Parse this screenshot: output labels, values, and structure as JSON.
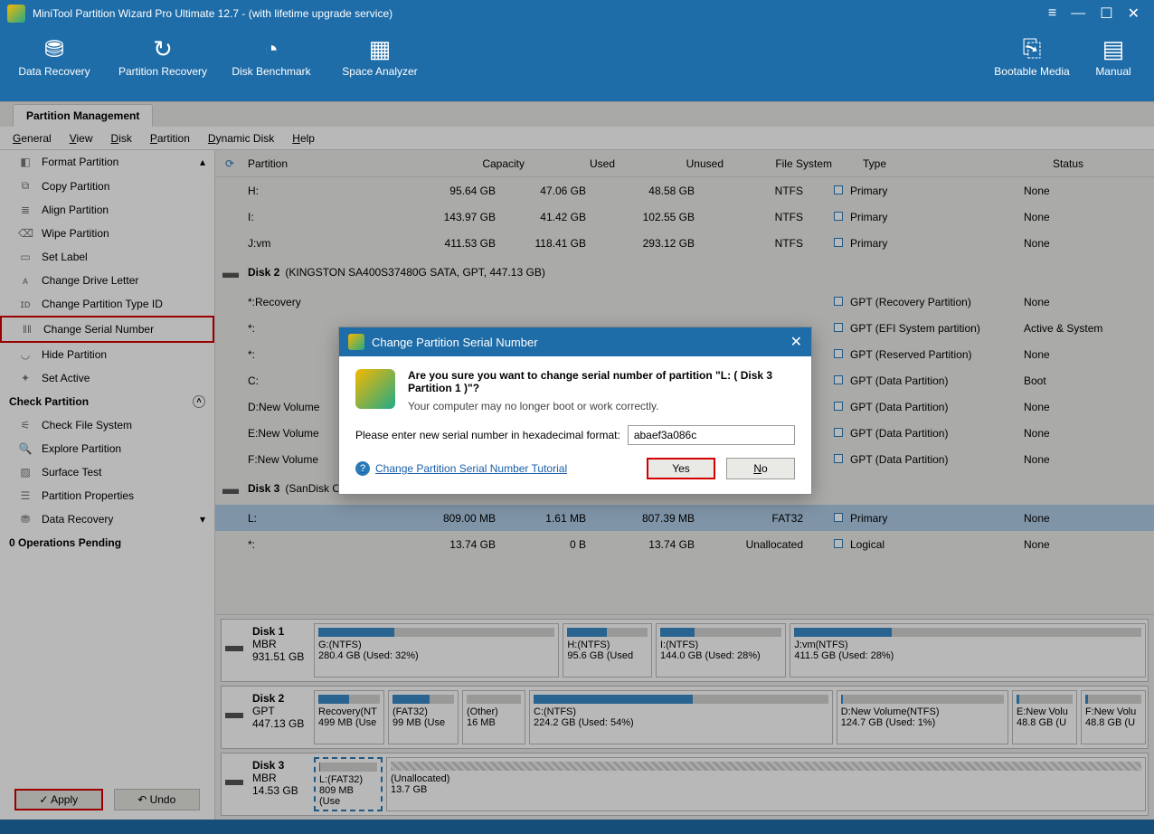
{
  "title": "MiniTool Partition Wizard Pro Ultimate 12.7 - (with lifetime upgrade service)",
  "ribbon": {
    "data_recovery": "Data Recovery",
    "partition_recovery": "Partition Recovery",
    "disk_benchmark": "Disk Benchmark",
    "space_analyzer": "Space Analyzer",
    "bootable": "Bootable Media",
    "manual": "Manual"
  },
  "tab": "Partition Management",
  "menus": {
    "general": "General",
    "view": "View",
    "disk": "Disk",
    "partition": "Partition",
    "dynamic": "Dynamic Disk",
    "help": "Help"
  },
  "sidebar": {
    "items": [
      "Format Partition",
      "Copy Partition",
      "Align Partition",
      "Wipe Partition",
      "Set Label",
      "Change Drive Letter",
      "Change Partition Type ID",
      "Change Serial Number",
      "Hide Partition",
      "Set Active"
    ],
    "check_section": "Check Partition",
    "check_items": [
      "Check File System",
      "Explore Partition",
      "Surface Test",
      "Partition Properties",
      "Data Recovery"
    ],
    "pending": "0 Operations Pending",
    "apply": "Apply",
    "undo": "Undo"
  },
  "grid": {
    "head": {
      "p": "Partition",
      "c": "Capacity",
      "u": "Used",
      "un": "Unused",
      "fs": "File System",
      "t": "Type",
      "s": "Status"
    },
    "rows1": [
      {
        "p": "H:",
        "c": "95.64 GB",
        "u": "47.06 GB",
        "un": "48.58 GB",
        "fs": "NTFS",
        "t": "Primary",
        "s": "None"
      },
      {
        "p": "I:",
        "c": "143.97 GB",
        "u": "41.42 GB",
        "un": "102.55 GB",
        "fs": "NTFS",
        "t": "Primary",
        "s": "None"
      },
      {
        "p": "J:vm",
        "c": "411.53 GB",
        "u": "118.41 GB",
        "un": "293.12 GB",
        "fs": "NTFS",
        "t": "Primary",
        "s": "None"
      }
    ],
    "disk2": {
      "name": "Disk 2",
      "desc": "(KINGSTON SA400S37480G SATA, GPT, 447.13 GB)"
    },
    "rows2": [
      {
        "p": "*:Recovery",
        "t": "GPT (Recovery Partition)",
        "s": "None"
      },
      {
        "p": "*:",
        "t": "GPT (EFI System partition)",
        "s": "Active & System"
      },
      {
        "p": "*:",
        "t": "GPT (Reserved Partition)",
        "s": "None"
      },
      {
        "p": "C:",
        "t": "GPT (Data Partition)",
        "s": "Boot"
      },
      {
        "p": "D:New Volume",
        "t": "GPT (Data Partition)",
        "s": "None"
      },
      {
        "p": "E:New Volume",
        "t": "GPT (Data Partition)",
        "s": "None"
      },
      {
        "p": "F:New Volume",
        "t": "GPT (Data Partition)",
        "s": "None"
      }
    ],
    "disk3": {
      "name": "Disk 3",
      "desc": "(SanDisk Cruzer Blade USB, Removable, MBR, 14.53 GB)"
    },
    "rows3": [
      {
        "p": "L:",
        "c": "809.00 MB",
        "u": "1.61 MB",
        "un": "807.39 MB",
        "fs": "FAT32",
        "t": "Primary",
        "s": "None"
      },
      {
        "p": "*:",
        "c": "13.74 GB",
        "u": "0 B",
        "un": "13.74 GB",
        "fs": "Unallocated",
        "t": "Logical",
        "s": "None"
      }
    ]
  },
  "dm": {
    "d1": {
      "name": "Disk 1",
      "type": "MBR",
      "size": "931.51 GB",
      "p1": {
        "n": "G:(NTFS)",
        "d": "280.4 GB (Used: 32%)"
      },
      "p2": {
        "n": "H:(NTFS)",
        "d": "95.6 GB (Used"
      },
      "p3": {
        "n": "I:(NTFS)",
        "d": "144.0 GB (Used: 28%)"
      },
      "p4": {
        "n": "J:vm(NTFS)",
        "d": "411.5 GB (Used: 28%)"
      }
    },
    "d2": {
      "name": "Disk 2",
      "type": "GPT",
      "size": "447.13 GB",
      "p1": {
        "n": "Recovery(NT",
        "d": "499 MB (Use"
      },
      "p2": {
        "n": "(FAT32)",
        "d": "99 MB (Use"
      },
      "p3": {
        "n": "(Other)",
        "d": "16 MB"
      },
      "p4": {
        "n": "C:(NTFS)",
        "d": "224.2 GB (Used: 54%)"
      },
      "p5": {
        "n": "D:New Volume(NTFS)",
        "d": "124.7 GB (Used: 1%)"
      },
      "p6": {
        "n": "E:New Volu",
        "d": "48.8 GB (U"
      },
      "p7": {
        "n": "F:New Volu",
        "d": "48.8 GB (U"
      }
    },
    "d3": {
      "name": "Disk 3",
      "type": "MBR",
      "size": "14.53 GB",
      "p1": {
        "n": "L:(FAT32)",
        "d": "809 MB (Use"
      },
      "p2": {
        "n": "(Unallocated)",
        "d": "13.7 GB"
      }
    }
  },
  "dialog": {
    "title": "Change Partition Serial Number",
    "warn_bold": "Are you sure you want to change serial number of partition \"L: ( Disk 3 Partition 1 )\"?",
    "warn_sub": "Your computer may no longer boot or work correctly.",
    "input_label": "Please enter new serial number in hexadecimal format:",
    "input_value": "abaef3a086c",
    "help": "Change Partition Serial Number Tutorial",
    "yes": "Yes",
    "no": "No"
  }
}
